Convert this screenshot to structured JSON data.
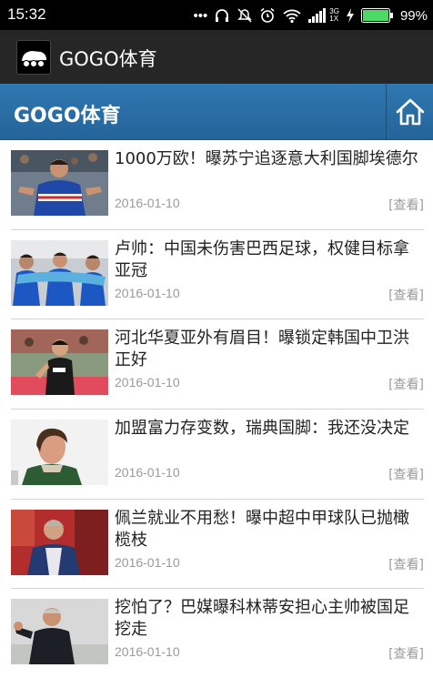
{
  "status_bar": {
    "time": "15:32",
    "network_type": "3G",
    "network_sub": "1X",
    "battery": "99%"
  },
  "app_bar": {
    "title": "GOGO体育",
    "icon": "gogo-logo-icon"
  },
  "site_header": {
    "title": "GOGO体育",
    "home_icon": "home-icon",
    "color": "#2b6fa8"
  },
  "news": [
    {
      "title": "1000万欧！曝苏宁追逐意大利国脚埃德尔",
      "date": "2016-01-10",
      "view": "[查看]"
    },
    {
      "title": "卢帅：中国未伤害巴西足球，权健目标拿亚冠",
      "date": "2016-01-10",
      "view": "[查看]"
    },
    {
      "title": "河北华夏亚外有眉目！曝锁定韩国中卫洪正好",
      "date": "2016-01-10",
      "view": "[查看]"
    },
    {
      "title": "加盟富力存变数，瑞典国脚：我还没决定",
      "date": "2016-01-10",
      "view": "[查看]"
    },
    {
      "title": "佩兰就业不用愁！曝中超中甲球队已抛橄榄枝",
      "date": "2016-01-10",
      "view": "[查看]"
    },
    {
      "title": "挖怕了？巴媒曝科林蒂安担心主帅被国足挖走",
      "date": "2016-01-10",
      "view": "[查看]"
    }
  ]
}
